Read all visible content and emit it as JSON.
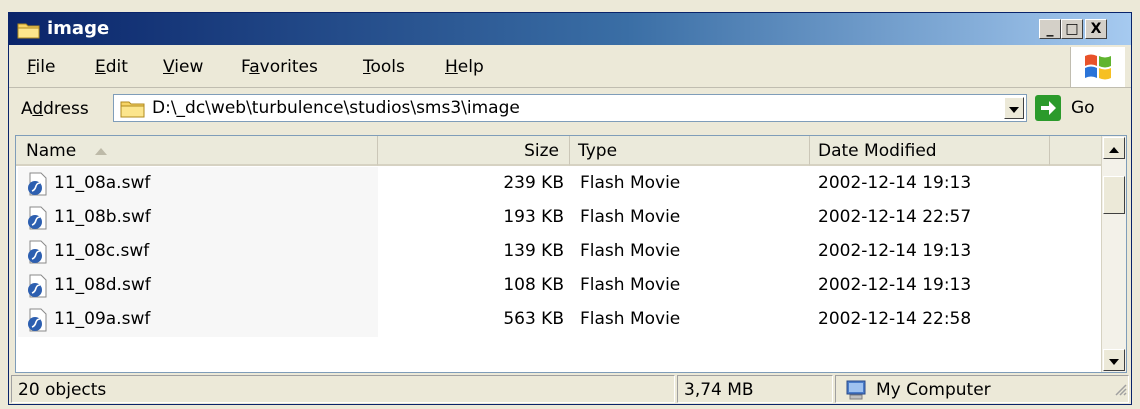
{
  "window": {
    "title": "image",
    "controls": {
      "minimize": "_",
      "maximize": "□",
      "close": "X"
    }
  },
  "menu": [
    {
      "label": "File",
      "hotkey": "F",
      "rest": "ile"
    },
    {
      "label": "Edit",
      "hotkey": "E",
      "rest": "dit"
    },
    {
      "label": "View",
      "hotkey": "V",
      "rest": "iew"
    },
    {
      "label": "Favorites",
      "pre": "F",
      "hotkey": "a",
      "rest": "vorites"
    },
    {
      "label": "Tools",
      "hotkey": "T",
      "rest": "ools"
    },
    {
      "label": "Help",
      "hotkey": "H",
      "rest": "elp"
    }
  ],
  "address": {
    "label_pre": "A",
    "label_hotkey": "d",
    "label_rest": "dress",
    "path": "D:\\_dc\\web\\turbulence\\studios\\sms3\\image",
    "go_label": "Go"
  },
  "columns": {
    "name": "Name",
    "size": "Size",
    "type": "Type",
    "date": "Date Modified"
  },
  "files": [
    {
      "name": "11_08a.swf",
      "size": "239 KB",
      "type": "Flash Movie",
      "date": "2002-12-14 19:13"
    },
    {
      "name": "11_08b.swf",
      "size": "193 KB",
      "type": "Flash Movie",
      "date": "2002-12-14 22:57"
    },
    {
      "name": "11_08c.swf",
      "size": "139 KB",
      "type": "Flash Movie",
      "date": "2002-12-14 19:13"
    },
    {
      "name": "11_08d.swf",
      "size": "108 KB",
      "type": "Flash Movie",
      "date": "2002-12-14 19:13"
    },
    {
      "name": "11_09a.swf",
      "size": "563 KB",
      "type": "Flash Movie",
      "date": "2002-12-14 22:58"
    }
  ],
  "status": {
    "objects": "20 objects",
    "total_size": "3,74 MB",
    "location": "My Computer"
  },
  "colors": {
    "title_start": "#0a246a",
    "title_end": "#a6caf0",
    "chrome": "#ece9d8"
  }
}
